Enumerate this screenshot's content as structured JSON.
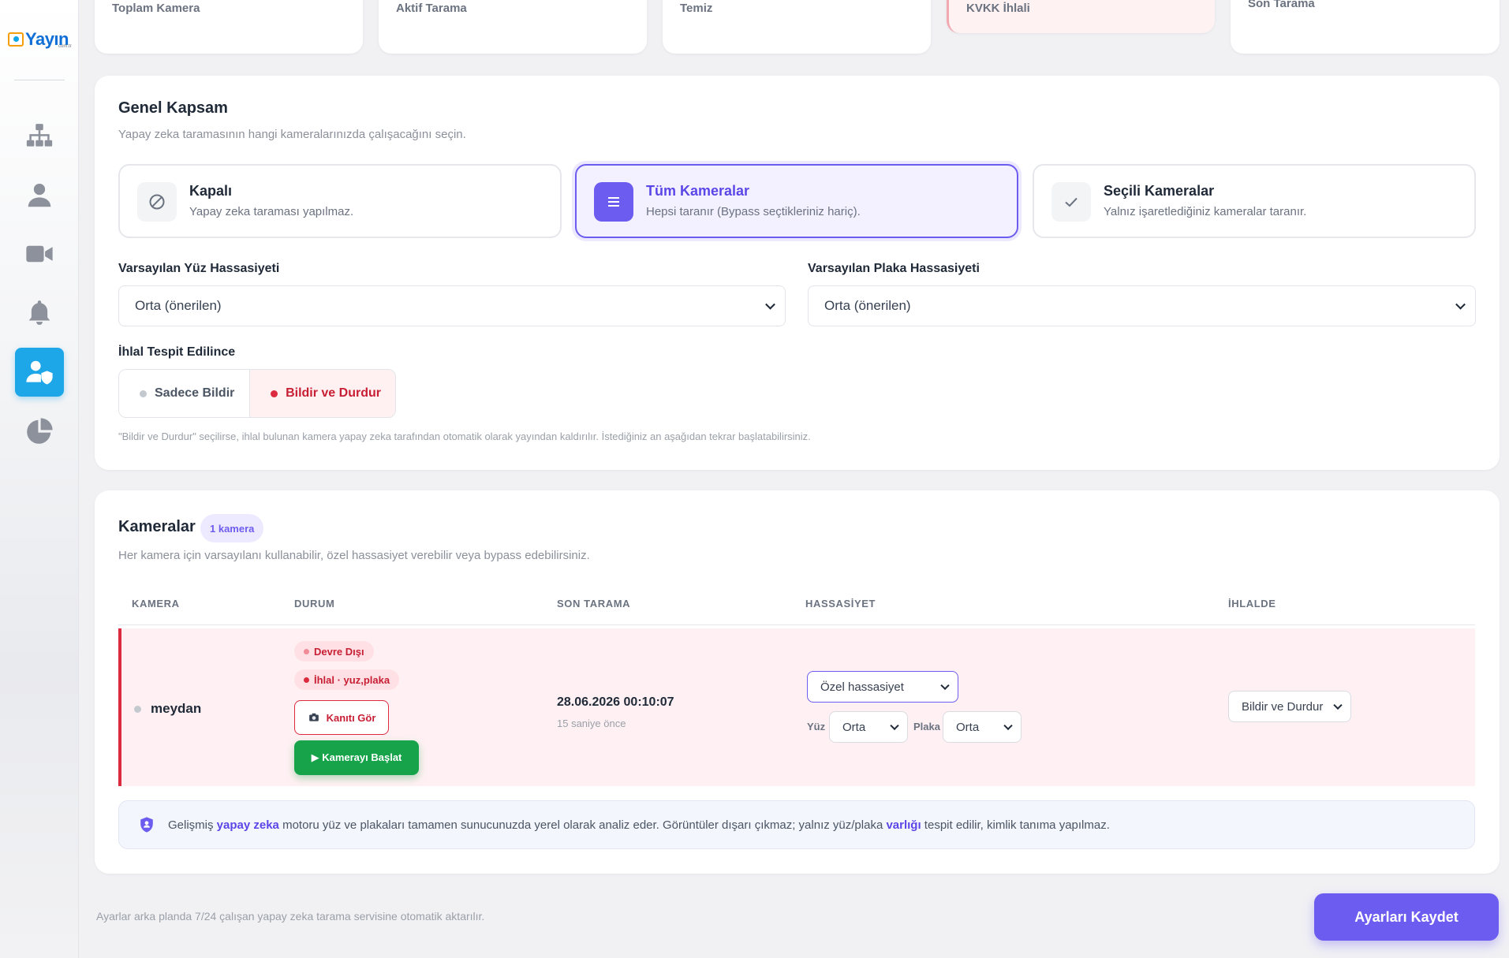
{
  "brand": {
    "logo_text": "Yayın",
    "logo_sub": "com.tr"
  },
  "sidebar": {
    "items": [
      {
        "icon": "sitemap-icon",
        "active": false
      },
      {
        "icon": "user-icon",
        "active": false
      },
      {
        "icon": "video-camera-icon",
        "active": false
      },
      {
        "icon": "bell-icon",
        "active": false
      },
      {
        "icon": "user-shield-icon",
        "active": true
      },
      {
        "icon": "pie-chart-icon",
        "active": false
      }
    ]
  },
  "stats": [
    {
      "label": "Toplam Kamera"
    },
    {
      "label": "Aktif Tarama"
    },
    {
      "label": "Temiz"
    },
    {
      "label": "KVKK İhlali"
    },
    {
      "label": "Son Tarama"
    }
  ],
  "scope": {
    "title": "Genel Kapsam",
    "subtitle": "Yapay zeka taramasının hangi kameralarınızda çalışacağını seçin.",
    "options": [
      {
        "title": "Kapalı",
        "desc": "Yapay zeka taraması yapılmaz.",
        "icon": "ban-icon",
        "selected": false
      },
      {
        "title": "Tüm Kameralar",
        "desc": "Hepsi taranır (Bypass seçtikleriniz hariç).",
        "icon": "list-icon",
        "selected": true
      },
      {
        "title": "Seçili Kameralar",
        "desc": "Yalnız işaretlediğiniz kameralar taranır.",
        "icon": "check-icon",
        "selected": false
      }
    ],
    "face_label": "Varsayılan Yüz Hassasiyeti",
    "face_value": "Orta (önerilen)",
    "plate_label": "Varsayılan Plaka Hassasiyeti",
    "plate_value": "Orta (önerilen)",
    "violation_label": "İhlal Tespit Edilince",
    "violation_options": [
      "Sadece Bildir",
      "Bildir ve Durdur"
    ],
    "violation_selected": "Bildir ve Durdur",
    "hint": "\"Bildir ve Durdur\" seçilirse, ihlal bulunan kamera yapay zeka tarafından otomatik olarak yayından kaldırılır. İstediğiniz an aşağıdan tekrar başlatabilirsiniz."
  },
  "cameras": {
    "title": "Kameralar",
    "count_badge": "1 kamera",
    "subtitle": "Her kamera için varsayılanı kullanabilir, özel hassasiyet verebilir veya bypass edebilirsiniz.",
    "columns": [
      "KAMERA",
      "DURUM",
      "SON TARAMA",
      "HASSASİYET",
      "İHLALDE"
    ],
    "rows": [
      {
        "name": "meydan",
        "status_disabled": "Devre Dışı",
        "status_violation": "İhlal · yuz,plaka",
        "evidence_label": "Kanıtı Gör",
        "start_label": "▶ Kamerayı Başlat",
        "scan_time": "28.06.2026 00:10:07",
        "scan_ago": "15 saniye önce",
        "sensitivity": "Özel hassasiyet",
        "face_label": "Yüz",
        "face_value": "Orta",
        "plate_label": "Plaka",
        "plate_value": "Orta",
        "on_violation": "Bildir ve Durdur"
      }
    ],
    "info_parts": [
      "Gelişmiş ",
      "yapay zeka",
      " motoru yüz ve plakaları tamamen sunucunuzda yerel olarak analiz eder. Görüntüler dışarı çıkmaz; yalnız yüz/plaka ",
      "varlığı",
      " tespit edilir, kimlik tanıma yapılmaz."
    ]
  },
  "footer": {
    "note": "Ayarlar arka planda 7/24 çalışan yapay zeka tarama servisine otomatik aktarılır.",
    "save_label": "Ayarları Kaydet"
  },
  "colors": {
    "accent": "#6d5cf0",
    "danger": "#dc2b3f",
    "success": "#16a34a",
    "active_nav": "#1ea7e8"
  }
}
